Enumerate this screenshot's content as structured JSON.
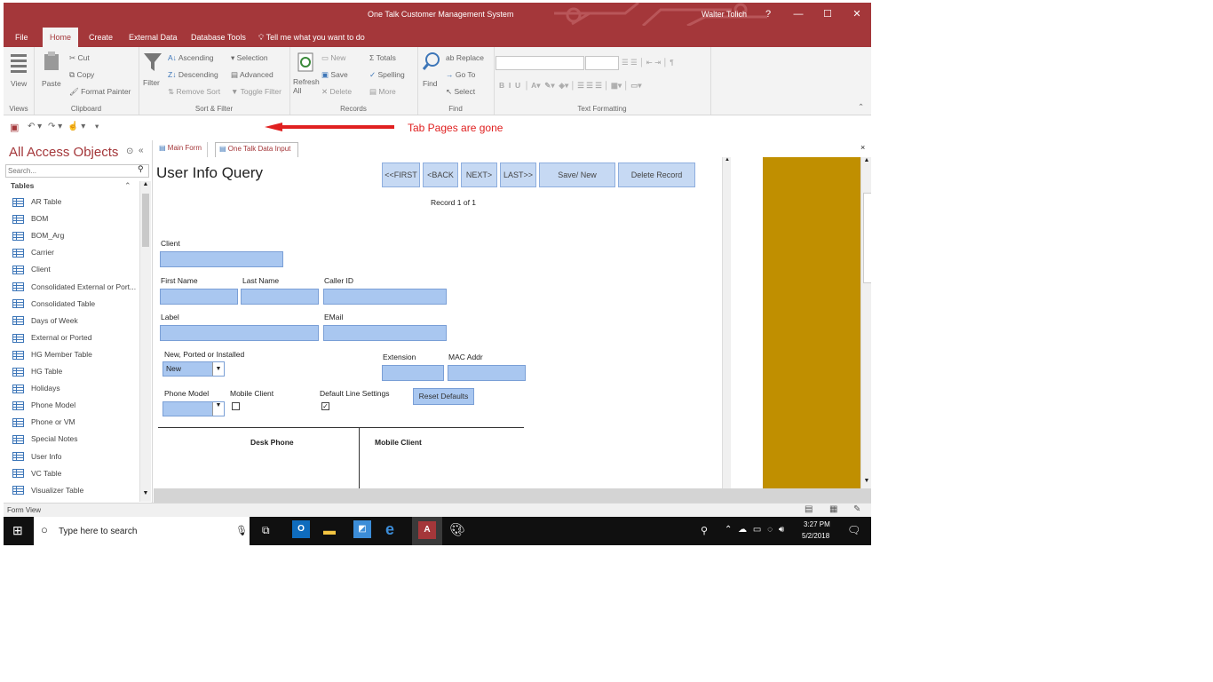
{
  "window": {
    "title": "One Talk Customer Management System",
    "user": "Walter Tolich",
    "help": "?",
    "minimize": "—",
    "restore": "☐",
    "close": "✕"
  },
  "ribbon_tabs": [
    "File",
    "Home",
    "Create",
    "External Data",
    "Database Tools"
  ],
  "tell_me": "Tell me what you want to do",
  "ribbon": {
    "views": {
      "view": "View",
      "label": "Views"
    },
    "clipboard": {
      "paste": "Paste",
      "cut": "Cut",
      "copy": "Copy",
      "format_painter": "Format Painter",
      "label": "Clipboard"
    },
    "sort_filter": {
      "filter": "Filter",
      "ascending": "Ascending",
      "descending": "Descending",
      "remove_sort": "Remove Sort",
      "selection": "Selection",
      "advanced": "Advanced",
      "toggle_filter": "Toggle Filter",
      "label": "Sort & Filter"
    },
    "records": {
      "refresh": "Refresh All",
      "new": "New",
      "save": "Save",
      "delete": "Delete",
      "totals": "Totals",
      "spelling": "Spelling",
      "more": "More",
      "label": "Records"
    },
    "find": {
      "find": "Find",
      "replace": "Replace",
      "goto": "Go To",
      "select": "Select",
      "label": "Find"
    },
    "text_formatting": {
      "label": "Text Formatting"
    }
  },
  "annotation": "Tab Pages are gone",
  "nav": {
    "title": "All Access Objects",
    "search_placeholder": "Search...",
    "section": "Tables",
    "items": [
      "AR Table",
      "BOM",
      "BOM_Arg",
      "Carrier",
      "Client",
      "Consolidated External or Port...",
      "Consolidated Table",
      "Days of Week",
      "External or Ported",
      "HG Member Table",
      "HG Table",
      "Holidays",
      "Phone Model",
      "Phone or VM",
      "Special Notes",
      "User Info",
      "VC Table",
      "Visualizer Table"
    ]
  },
  "doc_tabs": [
    "Main Form",
    "One Talk Data Input"
  ],
  "form": {
    "title": "User Info Query",
    "buttons": {
      "first": "<<FIRST",
      "back": "<BACK",
      "next": "NEXT>",
      "last": "LAST>>",
      "save_new": "Save/ New",
      "delete": "Delete Record"
    },
    "record": "Record 1 of 1",
    "labels": {
      "client": "Client",
      "first_name": "First Name",
      "last_name": "Last Name",
      "caller_id": "Caller ID",
      "label": "Label",
      "email": "EMail",
      "new_ported": "New, Ported or Installed",
      "extension": "Extension",
      "mac": "MAC Addr",
      "phone_model": "Phone Model",
      "mobile_client": "Mobile Client",
      "default_line": "Default Line Settings"
    },
    "new_ported_value": "New",
    "reset_defaults": "Reset Defaults",
    "default_line_checked": "✓",
    "subheaders": {
      "desk": "Desk Phone",
      "mobile": "Mobile Client"
    }
  },
  "status": "Form View",
  "taskbar": {
    "search": "Type here to search",
    "time": "3:27 PM",
    "date": "5/2/2018"
  },
  "colors": {
    "accent": "#a4373a",
    "field": "#a9c7f0",
    "gold": "#c08f00",
    "annotation": "#e02020"
  }
}
